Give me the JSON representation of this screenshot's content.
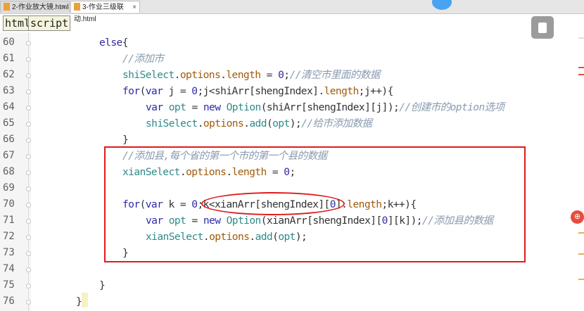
{
  "tabs": [
    {
      "label": "2-作业放大镜.html",
      "close": "×"
    },
    {
      "label": "3-作业三级联动.html",
      "close": "×"
    }
  ],
  "toolbar": {
    "html_label": "html",
    "script_label": "script"
  },
  "side_button_label": "⊕",
  "code_lines": [
    {
      "num": "60",
      "text": "else{"
    },
    {
      "num": "61",
      "text": "//添加市"
    },
    {
      "num": "62",
      "text": "shiSelect.options.length = 0;//清空市里面的数据"
    },
    {
      "num": "63",
      "text": "for(var j = 0;j<shiArr[shengIndex].length;j++){"
    },
    {
      "num": "64",
      "text": "var opt = new Option(shiArr[shengIndex][j]);//创建市的option选项"
    },
    {
      "num": "65",
      "text": "shiSelect.options.add(opt);//给市添加数据"
    },
    {
      "num": "66",
      "text": "}"
    },
    {
      "num": "67",
      "text": "//添加县,每个省的第一个市的第一个县的数据"
    },
    {
      "num": "68",
      "text": "xianSelect.options.length = 0;"
    },
    {
      "num": "69",
      "text": ""
    },
    {
      "num": "70",
      "text": "for(var k = 0;k<xianArr[shengIndex][0].length;k++){"
    },
    {
      "num": "71",
      "text": "var opt = new Option(xianArr[shengIndex][0][k]);//添加县的数据"
    },
    {
      "num": "72",
      "text": "xianSelect.options.add(opt);"
    },
    {
      "num": "73",
      "text": "}"
    },
    {
      "num": "74",
      "text": ""
    },
    {
      "num": "75",
      "text": "}"
    },
    {
      "num": "76",
      "text": "}"
    }
  ],
  "colors": {
    "annotation": "#e01b1b",
    "keyword": "#2f2aa6",
    "comment": "#8a9bb0"
  }
}
